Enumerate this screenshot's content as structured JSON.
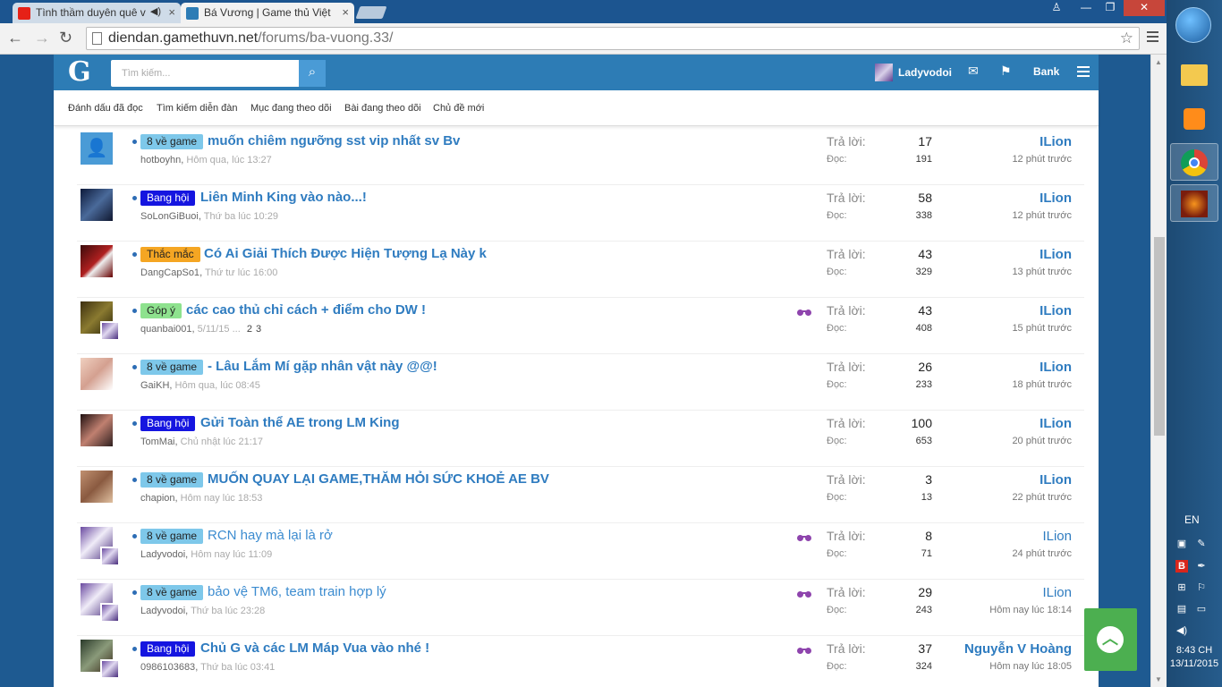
{
  "browser": {
    "tabs": [
      {
        "title": "Tình thầm duyên quê v",
        "active": false,
        "icon_color": "#e62117"
      },
      {
        "title": "Bá Vương | Game thủ Việt",
        "active": true,
        "icon_color": "#2d7cb5"
      }
    ],
    "url_domain": "diendan.gamethuvn.net",
    "url_path": "/forums/ba-vuong.33/"
  },
  "site": {
    "logo": "G",
    "search_placeholder": "Tìm kiếm...",
    "username": "Ladyvodoi",
    "bank_label": "Bank",
    "subnav": [
      "Đánh dấu đã đọc",
      "Tìm kiếm diễn đàn",
      "Mục đang theo dõi",
      "Bài đang theo dõi",
      "Chủ đề mới"
    ]
  },
  "labels": {
    "replies": "Trả lời:",
    "views": "Đọc:"
  },
  "prefix_styles": {
    "8 về game": {
      "bg": "#7ec8ea",
      "fg": "#222222"
    },
    "Bang hội": {
      "bg": "#1515e0",
      "fg": "#ffffff"
    },
    "Thắc mắc": {
      "bg": "#f5a623",
      "fg": "#222222"
    },
    "Góp ý": {
      "bg": "#8ee28e",
      "fg": "#222222"
    }
  },
  "threads": [
    {
      "prefix": "8 về game",
      "title": "muốn chiêm ngưỡng sst vip nhất sv Bv",
      "unread": true,
      "author": "hotboyhn",
      "date": "Hôm qua, lúc 13:27",
      "pages": [],
      "watched": false,
      "replies": "17",
      "views": "191",
      "last_poster": "ILion",
      "last_time": "12 phút trước",
      "avatar": "default"
    },
    {
      "prefix": "Bang hội",
      "title": "Liên Minh King vào nào...!",
      "unread": true,
      "author": "SoLonGiBuoi",
      "date": "Thứ ba lúc 10:29",
      "pages": [],
      "watched": false,
      "replies": "58",
      "views": "338",
      "last_poster": "ILion",
      "last_time": "12 phút trước",
      "avatar": "dark"
    },
    {
      "prefix": "Thắc mắc",
      "title": "Có Ai Giải Thích Được Hiện Tượng Lạ Này k",
      "unread": true,
      "author": "DangCapSo1",
      "date": "Thứ tư lúc 16:00",
      "pages": [],
      "watched": false,
      "replies": "43",
      "views": "329",
      "last_poster": "ILion",
      "last_time": "13 phút trước",
      "avatar": "red"
    },
    {
      "prefix": "Góp ý",
      "title": "các cao thủ chỉ cách + điểm cho DW !",
      "unread": true,
      "author": "quanbai001",
      "date": "5/11/15",
      "pages": [
        "2",
        "3"
      ],
      "watched": true,
      "replies": "43",
      "views": "408",
      "last_poster": "ILion",
      "last_time": "15 phút trước",
      "avatar": "olive",
      "sub_avatar": true
    },
    {
      "prefix": "8 về game",
      "title": "- Lâu Lắm Mí gặp nhân vật này @@!",
      "unread": true,
      "author": "GaiKH",
      "date": "Hôm qua, lúc 08:45",
      "pages": [],
      "watched": false,
      "replies": "26",
      "views": "233",
      "last_poster": "ILion",
      "last_time": "18 phút trước",
      "avatar": "face"
    },
    {
      "prefix": "Bang hội",
      "title": "Gửi Toàn thể AE trong LM King",
      "unread": true,
      "author": "TomMai",
      "date": "Chủ nhật lúc 21:17",
      "pages": [],
      "watched": false,
      "replies": "100",
      "views": "653",
      "last_poster": "ILion",
      "last_time": "20 phút trước",
      "avatar": "group"
    },
    {
      "prefix": "8 về game",
      "title": "MUỐN QUAY LẠI GAME,THĂM HỎI SỨC KHOẺ AE BV",
      "unread": true,
      "author": "chapion",
      "date": "Hôm nay lúc 18:53",
      "pages": [],
      "watched": false,
      "replies": "3",
      "views": "13",
      "last_poster": "ILion",
      "last_time": "22 phút trước",
      "avatar": "tan"
    },
    {
      "prefix": "8 về game",
      "title": "RCN hay mà lại là rở",
      "unread": false,
      "author": "Ladyvodoi",
      "date": "Hôm nay lúc 11:09",
      "pages": [],
      "watched": true,
      "replies": "8",
      "views": "71",
      "last_poster": "ILion",
      "last_time": "24 phút trước",
      "avatar": "purple",
      "sub_avatar": true
    },
    {
      "prefix": "8 về game",
      "title": "bảo vệ TM6, team train hợp lý",
      "unread": false,
      "author": "Ladyvodoi",
      "date": "Thứ ba lúc 23:28",
      "pages": [],
      "watched": true,
      "replies": "29",
      "views": "243",
      "last_poster": "ILion",
      "last_time": "Hôm nay lúc 18:14",
      "avatar": "purple",
      "sub_avatar": true
    },
    {
      "prefix": "Bang hội",
      "title": "Chủ G và các LM Máp Vua vào nhé !",
      "unread": true,
      "author": "0986103683",
      "date": "Thứ ba lúc 03:41",
      "pages": [],
      "watched": true,
      "replies": "37",
      "views": "324",
      "last_poster": "Nguyễn V Hoàng",
      "last_time": "Hôm nay lúc 18:05",
      "avatar": "battle",
      "sub_avatar": true,
      "last_bold": true
    }
  ],
  "taskbar": {
    "lang": "EN",
    "time": "8:43 CH",
    "date": "13/11/2015"
  }
}
